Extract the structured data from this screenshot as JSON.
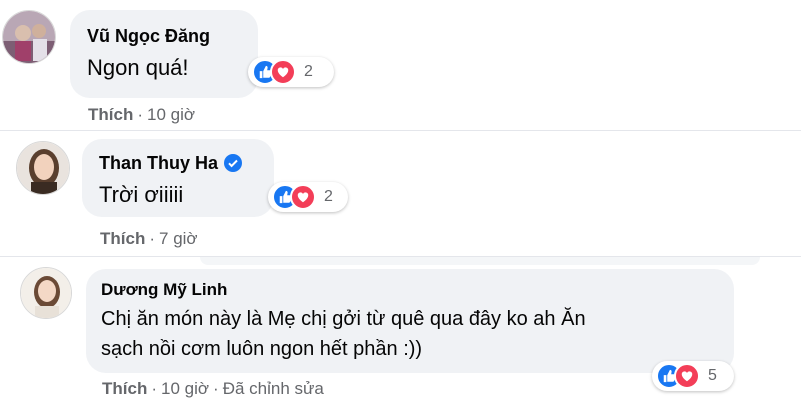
{
  "comments": [
    {
      "author": "Vũ Ngọc Đăng",
      "text": "Ngon quá!",
      "reaction_count": "2",
      "action": "Thích",
      "time": "10 giờ"
    },
    {
      "author": "Than Thuy Ha",
      "verified": true,
      "text": "Trời ơiiiii",
      "reaction_count": "2",
      "action": "Thích",
      "time": "7 giờ"
    },
    {
      "author": "Dương Mỹ Linh",
      "text_line1": "Chị ăn món này là Mẹ chị gởi từ quê qua đây ko ah Ăn",
      "text_line2": "sạch nồi cơm luôn ngon hết phần :))",
      "reaction_count": "5",
      "action": "Thích",
      "time": "10 giờ",
      "edited": "Đã chỉnh sửa"
    }
  ],
  "icons": {
    "like": "like-icon",
    "love": "love-icon",
    "verified": "verified-badge-icon"
  },
  "colors": {
    "bubble": "#f0f2f5",
    "like": "#1877f2",
    "love": "#f33e58",
    "meta": "#65676b",
    "verified": "#1877f2"
  }
}
